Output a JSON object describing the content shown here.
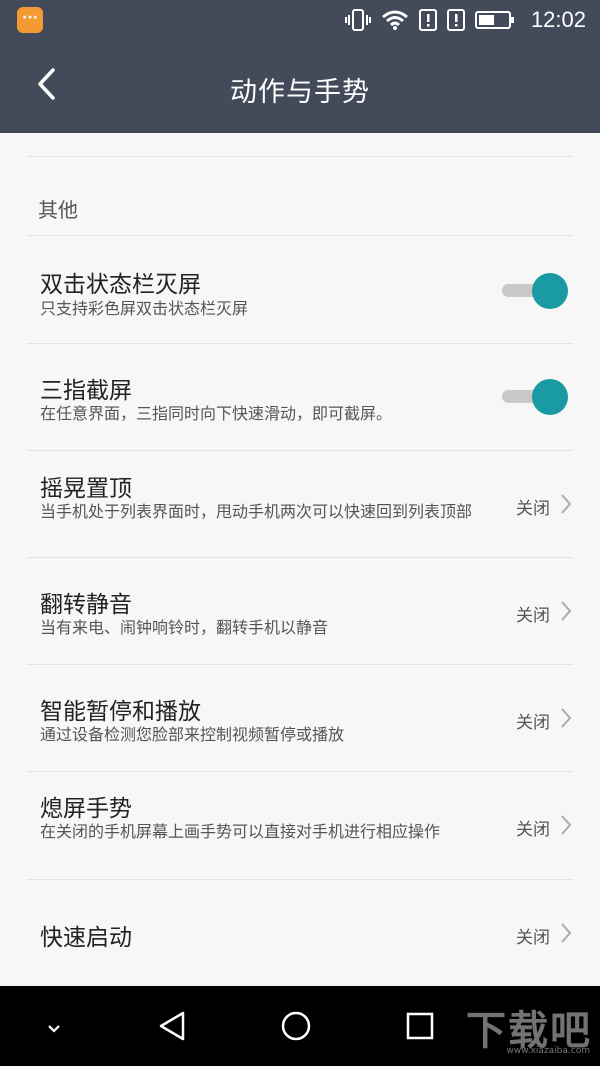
{
  "status_bar": {
    "time": "12:02",
    "icons": [
      "app-notification-icon",
      "vibrate-icon",
      "wifi-icon",
      "sim-alert-icon",
      "sim-alert-icon",
      "battery-icon"
    ]
  },
  "app_bar": {
    "title": "动作与手势",
    "back_icon": "chevron-left-icon"
  },
  "section": {
    "label": "其他"
  },
  "items": [
    {
      "title": "双击状态栏灭屏",
      "desc": "只支持彩色屏双击状态栏灭屏",
      "control": "toggle",
      "on": true
    },
    {
      "title": "三指截屏",
      "desc": "在任意界面，三指同时向下快速滑动，即可截屏。",
      "control": "toggle",
      "on": true
    },
    {
      "title": "摇晃置顶",
      "desc": "当手机处于列表界面时，甩动手机两次可以快速回到列表顶部",
      "control": "value",
      "value": "关闭"
    },
    {
      "title": "翻转静音",
      "desc": "当有来电、闹钟响铃时，翻转手机以静音",
      "control": "value",
      "value": "关闭"
    },
    {
      "title": "智能暂停和播放",
      "desc": "通过设备检测您脸部来控制视频暂停或播放",
      "control": "value",
      "value": "关闭"
    },
    {
      "title": "熄屏手势",
      "desc": "在关闭的手机屏幕上画手势可以直接对手机进行相应操作",
      "control": "value",
      "value": "关闭"
    },
    {
      "title": "快速启动",
      "desc": "",
      "control": "value",
      "value": "关闭"
    }
  ],
  "colors": {
    "header_bg": "#434a5a",
    "accent": "#1a9aa2",
    "page_bg": "#f7f7f7"
  },
  "watermark": {
    "text": "下载吧",
    "url": "www.xiazaiba.com"
  },
  "nav_bar": {
    "icons": [
      "chevron-down-icon",
      "back-triangle-icon",
      "home-circle-icon",
      "recents-square-icon"
    ]
  }
}
